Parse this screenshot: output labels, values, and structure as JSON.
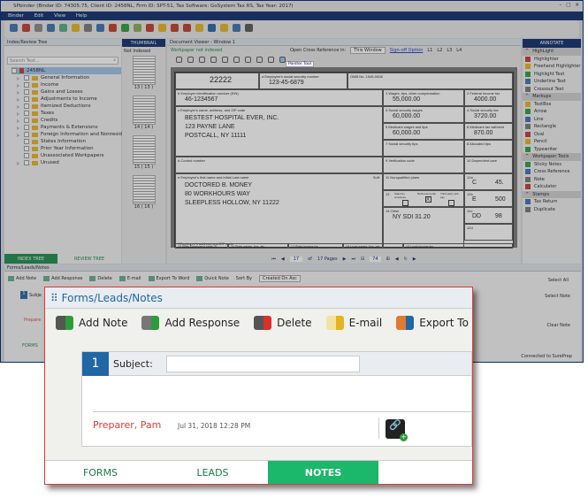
{
  "window": {
    "title": "SPbinder (Binder ID: 74305:75, Client ID: 2458NL, Firm ID: SPT-51, Tax Software: GoSystem Tax RS, Tax Year: 2017)",
    "controls": [
      "–",
      "□",
      "✕"
    ]
  },
  "menu": [
    "Binder",
    "Edit",
    "View",
    "Help"
  ],
  "index_panel": {
    "title": "Index/Review Tree",
    "search_placeholder": "Search Text...",
    "root": "2458NL",
    "items": [
      "General Information",
      "Income",
      "Gains and Losses",
      "Adjustments to Income",
      "Itemized Deductions",
      "Taxes",
      "Credits",
      "Payments & Extensions",
      "Foreign Information and Nonresident",
      "States Information",
      "Prior Year Information",
      "Unassociated Workpapers",
      "Unused"
    ],
    "tabs": [
      "INDEX TREE",
      "REVIEW TREE"
    ]
  },
  "thumbnails": {
    "tab": "THUMBNAIL",
    "filter": "Not Indexed",
    "pages": [
      "13 ( 13 )",
      "14 ( 14 )",
      "15 ( 15 )",
      "16 ( 16 )"
    ]
  },
  "viewer": {
    "title": "Document Viewer - Window 1",
    "status": "Workpaper not indexed",
    "cross_ref_label": "Open Cross Reference in:",
    "cross_ref_value": "This Window",
    "signoff": "Sign-off Option",
    "levels": [
      "L1",
      "L2",
      "L3",
      "L4"
    ],
    "tooltip": "Pointer Tool",
    "page": "17",
    "of": "of",
    "pages": "17 Pages",
    "zoom": "74"
  },
  "w2": {
    "code": "22222",
    "ssn_label": "a Employee's social security number",
    "ssn": "123-45-6879",
    "omb": "OMB No. 1545-0008",
    "ein_label": "b Employer identification number (EIN)",
    "ein": "46-1234567",
    "employer_label": "c Employer's name, address, and ZIP code",
    "employer": [
      "BESTEST HOSPITAL EVER, INC.",
      "123 PAYNE LANE",
      "POSTCALL, NY 11111"
    ],
    "control_label": "d Control number",
    "employee_label": "e Employee's first name and initial    Last name",
    "suff": "Suff.",
    "employee": [
      "DOCTORED B. MONEY",
      "80 WORKHOURS WAY",
      "SLEEPLESS HOLLOW, NY 11222"
    ],
    "employee_addr_label": "f Employee's address and ZIP code",
    "boxes": [
      {
        "label": "1 Wages, tips, other compensation",
        "value": "55,000.00"
      },
      {
        "label": "2 Federal income tax",
        "value": "4000.00"
      },
      {
        "label": "3 Social security wages",
        "value": "60,000.00"
      },
      {
        "label": "4 Social security tax",
        "value": "3720.00"
      },
      {
        "label": "5 Medicare wages and tips",
        "value": "60,000.00"
      },
      {
        "label": "6 Medicare tax withheld",
        "value": "870.00"
      },
      {
        "label": "7 Social security tips",
        "value": ""
      },
      {
        "label": "8 Allocated tips",
        "value": ""
      },
      {
        "label": "9 Verification code",
        "value": ""
      },
      {
        "label": "10 Dependent care",
        "value": ""
      },
      {
        "label": "11 Nonqualified plans",
        "value": ""
      },
      {
        "label": "14 Other",
        "value": "NY SDI  31.20"
      }
    ],
    "box13_label": "13",
    "box13": [
      "Statutory employee",
      "Retirement plan",
      "Third-party sick pay"
    ],
    "box13_checked": "X",
    "box12": [
      {
        "label": "12a",
        "code": "C",
        "value": "45."
      },
      {
        "label": "12b",
        "code": "E",
        "value": "500"
      },
      {
        "label": "12c",
        "code": "DD",
        "value": "98"
      },
      {
        "label": "12d",
        "code": "",
        "value": ""
      }
    ],
    "bottom": [
      "15 State   Employer's state ID number",
      "16 State wages, tips, etc.",
      "17 State income tax",
      "18 Local wages, tips, etc.",
      "19 Local income tax"
    ]
  },
  "annotate": {
    "title": "ANNOTATE",
    "sections": [
      {
        "name": "HighLight",
        "items": [
          "Highlighter",
          "Freehand Highlighter",
          "Highlight Text",
          "Underline Text",
          "Crossout Text"
        ]
      },
      {
        "name": "Markups",
        "items": [
          "TextBox",
          "Arrow",
          "Line",
          "Rectangle",
          "Oval",
          "Pencil",
          "Typewriter"
        ]
      },
      {
        "name": "Workpaper Tools",
        "items": [
          "Sticky Notes",
          "Cross Reference",
          "Note",
          "Calculator"
        ]
      },
      {
        "name": "Stamps",
        "items": [
          "Tax Return",
          "Duplicate"
        ]
      }
    ]
  },
  "notes_panel": {
    "title": "Forms/Leads/Notes",
    "toolbar": [
      "Add Note",
      "Add Response",
      "Delete",
      "E-mail",
      "Export To Word",
      "Quick Note"
    ],
    "sort_label": "Sort By",
    "sort_value": "Created On Asc",
    "select_all": "Select All",
    "select_note": "Select Note",
    "clear_note": "Clear Note",
    "subject_short": "Subje",
    "preparer_short": "Prepare",
    "forms_tab": "FORMS",
    "status": "Connected to SurePrep"
  },
  "popup": {
    "title": "Forms/Leads/Notes",
    "buttons": [
      "Add Note",
      "Add Response",
      "Delete",
      "E-mail",
      "Export To"
    ],
    "note_number": "1",
    "subject_label": "Subject:",
    "subject_value": "",
    "author": "Preparer, Pam",
    "timestamp": "Jul 31, 2018 12:28 PM",
    "tabs": [
      "FORMS",
      "LEADS",
      "NOTES"
    ],
    "active_tab": "NOTES"
  },
  "colors": {
    "navy": "#0b2a6b",
    "green_tab": "#1bb76a",
    "author_red": "#e53935",
    "note_blue": "#2166a5"
  }
}
